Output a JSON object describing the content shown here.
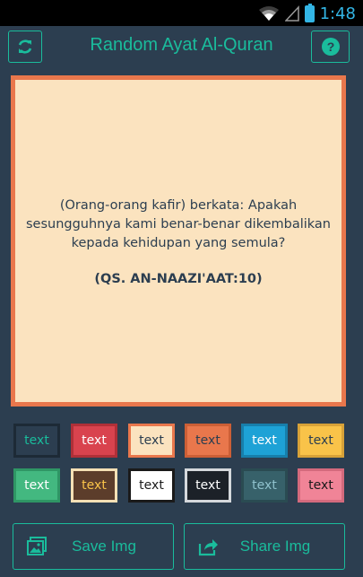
{
  "status_bar": {
    "time": "1:48"
  },
  "app_bar": {
    "title": "Random Ayat Al-Quran"
  },
  "quote": {
    "text": "(Orang-orang kafir) berkata: Apakah sesungguhnya kami benar-benar dikembalikan kepada kehidupan yang semula?",
    "reference": "(QS. AN-NAAZI'AAT:10)"
  },
  "swatches": [
    {
      "label": "text",
      "bg": "#2c3e50",
      "fg": "#1abc9c",
      "border": "#1d2a36"
    },
    {
      "label": "text",
      "bg": "#d9434e",
      "fg": "#ffffff",
      "border": "#b03038"
    },
    {
      "label": "text",
      "bg": "#fbe3bf",
      "fg": "#2c3e50",
      "border": "#e9774c"
    },
    {
      "label": "text",
      "bg": "#e9774c",
      "fg": "#2c3e50",
      "border": "#cc5f36"
    },
    {
      "label": "text",
      "bg": "#1ea2d6",
      "fg": "#ffffff",
      "border": "#177fab"
    },
    {
      "label": "text",
      "bg": "#f9c349",
      "fg": "#2c3e50",
      "border": "#d8a238"
    },
    {
      "label": "text",
      "bg": "#43b880",
      "fg": "#ffffff",
      "border": "#2f9665"
    },
    {
      "label": "text",
      "bg": "#5c3d2b",
      "fg": "#f9c349",
      "border": "#f5e0b5"
    },
    {
      "label": "text",
      "bg": "#ffffff",
      "fg": "#1a1a1a",
      "border": "#1a1a1a"
    },
    {
      "label": "text",
      "bg": "#1c2128",
      "fg": "#ffffff",
      "border": "#d5d8dc"
    },
    {
      "label": "text",
      "bg": "#37616a",
      "fg": "#8fc1cc",
      "border": "#2a4b52"
    },
    {
      "label": "text",
      "bg": "#f08497",
      "fg": "#1a1a1a",
      "border": "#d46a7d"
    }
  ],
  "actions": {
    "save_label": "Save Img",
    "share_label": "Share Img"
  },
  "colors": {
    "accent": "#1abc9c",
    "background": "#2c3e50",
    "status_accent": "#33b5e5"
  },
  "icons": {
    "refresh": "refresh-icon",
    "help": "help-icon",
    "save": "image-icon",
    "share": "share-icon",
    "wifi": "wifi-icon",
    "signal": "signal-icon",
    "battery": "battery-icon"
  }
}
